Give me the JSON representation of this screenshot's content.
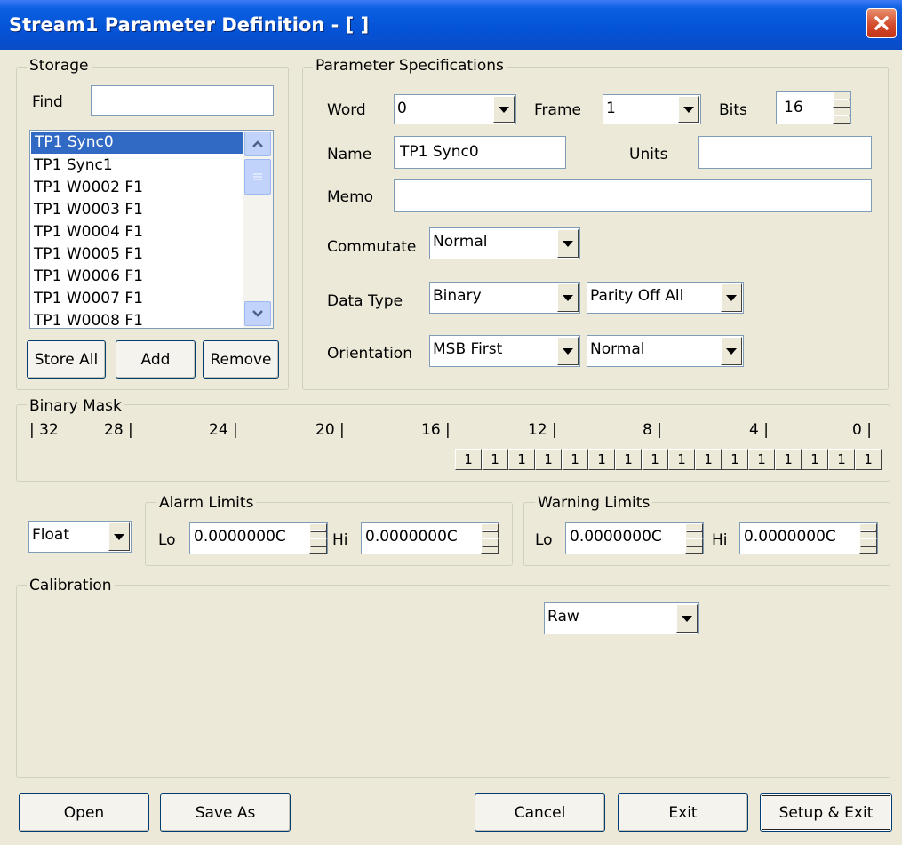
{
  "window": {
    "title": "Stream1 Parameter Definition - [  ]"
  },
  "storage": {
    "label": "Storage",
    "find_label": "Find",
    "find_value": "",
    "items": [
      "TP1 Sync0",
      "TP1 Sync1",
      "TP1 W0002 F1",
      "TP1 W0003 F1",
      "TP1 W0004 F1",
      "TP1 W0005 F1",
      "TP1 W0006 F1",
      "TP1 W0007 F1",
      "TP1 W0008 F1"
    ],
    "selected_index": 0,
    "store_all": "Store All",
    "add": "Add",
    "remove": "Remove"
  },
  "params": {
    "label": "Parameter Specifications",
    "word_label": "Word",
    "word_value": "0",
    "frame_label": "Frame",
    "frame_value": "1",
    "bits_label": "Bits",
    "bits_value": "16",
    "name_label": "Name",
    "name_value": "TP1 Sync0",
    "units_label": "Units",
    "units_value": "",
    "memo_label": "Memo",
    "memo_value": "",
    "commutate_label": "Commutate",
    "commutate_value": "Normal",
    "datatype_label": "Data Type",
    "datatype_value": "Binary",
    "parity_value": "Parity Off All",
    "orientation_label": "Orientation",
    "orientation_value": "MSB First",
    "orientation2_value": "Normal"
  },
  "mask": {
    "label": "Binary Mask",
    "scale": [
      "| 32",
      "28 |",
      "24 |",
      "20 |",
      "16 |",
      "12 |",
      "8 |",
      "4 |",
      "0 |"
    ],
    "bits": [
      "1",
      "1",
      "1",
      "1",
      "1",
      "1",
      "1",
      "1",
      "1",
      "1",
      "1",
      "1",
      "1",
      "1",
      "1",
      "1"
    ]
  },
  "limits": {
    "format_value": "Float",
    "alarm_label": "Alarm Limits",
    "warning_label": "Warning Limits",
    "lo_label": "Lo",
    "hi_label": "Hi",
    "alarm_lo": "0.0000000C",
    "alarm_hi": "0.0000000C",
    "warn_lo": "0.0000000C",
    "warn_hi": "0.0000000C"
  },
  "calibration": {
    "label": "Calibration",
    "mode_value": "Raw"
  },
  "buttons": {
    "open": "Open",
    "save_as": "Save As",
    "cancel": "Cancel",
    "exit": "Exit",
    "setup_exit": "Setup & Exit"
  },
  "colors": {
    "title_bar": "#0553d6",
    "dialog_bg": "#ece9d8",
    "selection": "#316ac5",
    "close_button": "#d2472a"
  }
}
